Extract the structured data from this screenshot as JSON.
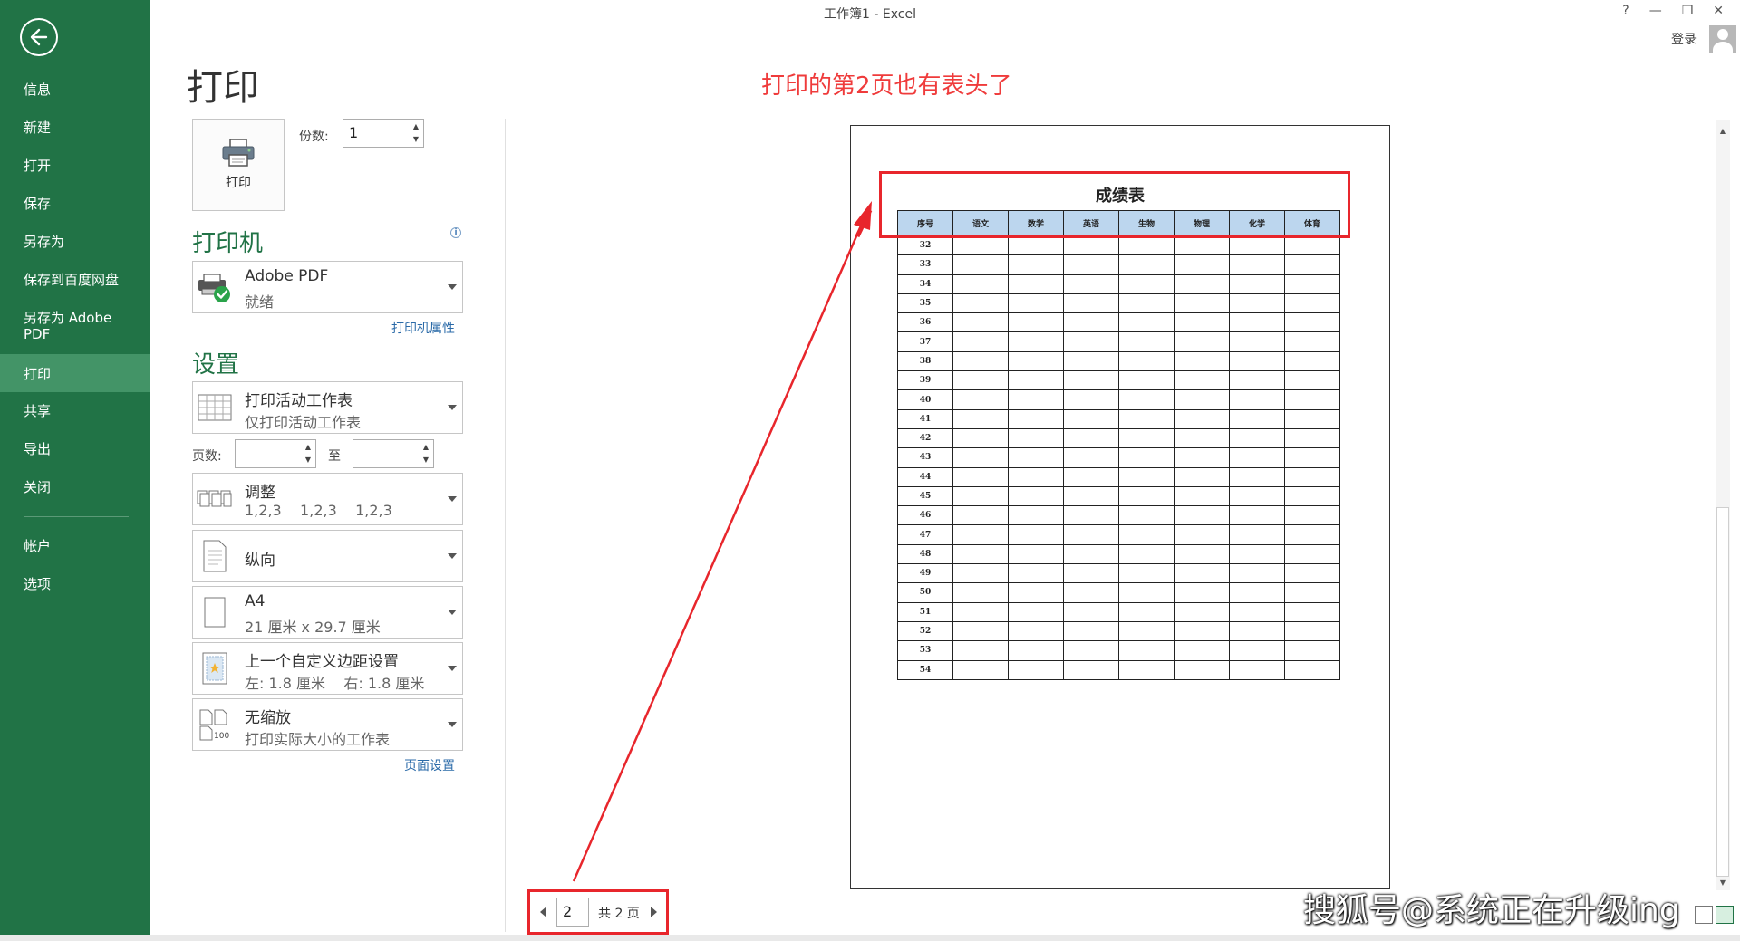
{
  "window": {
    "title": "工作簿1 - Excel",
    "controls": [
      "?",
      "—",
      "❐",
      "✕"
    ],
    "login": "登录"
  },
  "sidebar": {
    "back_icon": "back-arrow-icon",
    "items": [
      {
        "label": "信息"
      },
      {
        "label": "新建"
      },
      {
        "label": "打开"
      },
      {
        "label": "保存"
      },
      {
        "label": "另存为"
      },
      {
        "label": "保存到百度网盘"
      },
      {
        "label": "另存为 Adobe PDF"
      },
      {
        "label": "打印",
        "active": true
      },
      {
        "label": "共享"
      },
      {
        "label": "导出"
      },
      {
        "label": "关闭"
      },
      {
        "label": "帐户"
      },
      {
        "label": "选项"
      }
    ]
  },
  "print": {
    "title": "打印",
    "annotation": "打印的第2页也有表头了",
    "print_button": "打印",
    "copies_label": "份数:",
    "copies_value": "1",
    "printer_heading": "打印机",
    "printer_name": "Adobe PDF",
    "printer_status": "就绪",
    "printer_props_link": "打印机属性",
    "settings_heading": "设置",
    "settings": {
      "scope": {
        "line1": "打印活动工作表",
        "line2": "仅打印活动工作表"
      },
      "pages_label": "页数:",
      "pages_to": "至",
      "collate": {
        "line1": "调整",
        "line2": "1,2,3    1,2,3    1,2,3"
      },
      "orientation": {
        "line1": "纵向"
      },
      "paper": {
        "line1": "A4",
        "line2": "21 厘米 x 29.7 厘米"
      },
      "margins": {
        "line1": "上一个自定义边距设置",
        "line2": "左: 1.8 厘米    右: 1.8 厘米"
      },
      "scaling": {
        "line1": "无缩放",
        "line2": "打印实际大小的工作表"
      }
    },
    "page_setup_link": "页面设置"
  },
  "preview": {
    "sheet_title": "成绩表",
    "headers": [
      "序号",
      "语文",
      "数学",
      "英语",
      "生物",
      "物理",
      "化学",
      "体育"
    ],
    "row_numbers": [
      "32",
      "33",
      "34",
      "35",
      "36",
      "37",
      "38",
      "39",
      "40",
      "41",
      "42",
      "43",
      "44",
      "45",
      "46",
      "47",
      "48",
      "49",
      "50",
      "51",
      "52",
      "53",
      "54"
    ]
  },
  "pager": {
    "current_page": "2",
    "total_text": "共 2 页"
  },
  "watermark": "搜狐号@系统正在升级ing",
  "colors": {
    "sidebar_bg": "#217346",
    "sidebar_active": "#439467",
    "accent_red": "#e8262c",
    "header_fill": "#bcd6ee"
  }
}
